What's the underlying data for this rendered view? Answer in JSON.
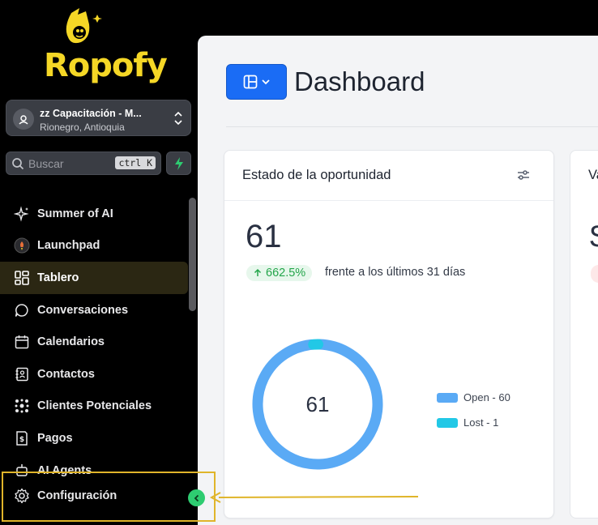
{
  "app": {
    "logo_text": "Ropofy"
  },
  "location": {
    "name": "zz Capacitación - M...",
    "city": "Rionegro, Antioquia"
  },
  "search": {
    "placeholder": "Buscar",
    "shortcut": "ctrl K"
  },
  "sidebar": {
    "items": [
      {
        "label": "Summer of AI",
        "icon": "sparkle-icon"
      },
      {
        "label": "Launchpad",
        "icon": "rocket-icon"
      },
      {
        "label": "Tablero",
        "icon": "grid-icon",
        "active": true
      },
      {
        "label": "Conversaciones",
        "icon": "chat-icon"
      },
      {
        "label": "Calendarios",
        "icon": "calendar-icon"
      },
      {
        "label": "Contactos",
        "icon": "contacts-icon"
      },
      {
        "label": "Clientes Potenciales",
        "icon": "network-icon"
      },
      {
        "label": "Pagos",
        "icon": "dollar-icon"
      },
      {
        "label": "AI Agents",
        "icon": "bot-icon"
      }
    ],
    "settings_label": "Configuración"
  },
  "header": {
    "title": "Dashboard"
  },
  "cards": [
    {
      "title": "Estado de la oportunidad",
      "value": "61",
      "trend": "662.5%",
      "trend_text": "frente a los últimos 31 días",
      "center_label": "61"
    },
    {
      "title": "Va",
      "value": "$"
    }
  ],
  "colors": {
    "accent": "#1a6cf5",
    "brand": "#f5d726",
    "open": "#5aaaf5",
    "lost": "#22c8e6",
    "collapse": "#2ecc71",
    "highlight": "#e0b52a"
  },
  "chart_data": {
    "type": "pie",
    "categories": [
      "Open",
      "Lost"
    ],
    "values": [
      60,
      1
    ],
    "legend": [
      "Open - 60",
      "Lost - 1"
    ],
    "legend_placement": "right"
  }
}
